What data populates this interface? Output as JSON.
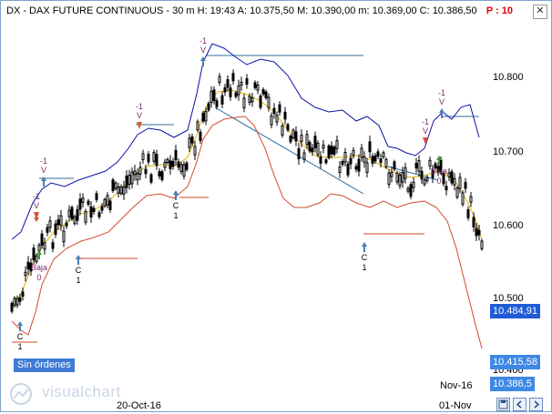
{
  "window": {
    "title": "DX - DAX FUTURE CONTINUOUS - 30 m  H: 19:43  A: 10.375,50  M: 10.390,00  m: 10.369,00  C: 10.386,50",
    "period_label": "P : 10",
    "close_glyph": "✕"
  },
  "price_axis": {
    "labels": [
      "10.800",
      "10.700",
      "10.600",
      "10.500",
      "10.400"
    ],
    "current_price_box": "10.484,91",
    "lower_box_1": "10.415,58",
    "lower_box_2": "10.386,5",
    "box_color_current": "#1f5bd6",
    "box_color_lower": "#3e88e6"
  },
  "date_axis": {
    "labels": [
      "20-Oct-16",
      "Nov-16",
      "01-Nov"
    ]
  },
  "status": {
    "no_orders_label": "Sin órdenes"
  },
  "logo": {
    "text": "visualchart"
  },
  "signals": [
    {
      "label": "C",
      "sub": "1"
    },
    {
      "label": "C",
      "sub": "1"
    },
    {
      "label": "C",
      "sub": "1"
    },
    {
      "label": "C",
      "sub": "1"
    },
    {
      "label": "-1",
      "sub": "V"
    },
    {
      "label": "-1",
      "sub": "V"
    },
    {
      "label": "-1",
      "sub": "V"
    },
    {
      "label": "-1",
      "sub": "V"
    },
    {
      "label": "-1",
      "sub": "V"
    },
    {
      "label": "-1",
      "sub": "V"
    },
    {
      "label": "Baja",
      "sub": "0"
    },
    {
      "label": "Baja",
      "sub": "0"
    }
  ],
  "colors": {
    "candles": "#000000",
    "upper_band": "#0a12a8",
    "mid_line": "#e2b400",
    "lower_band": "#d24a2e",
    "trendline": "#2f6e9e",
    "buy_arrow": "#4a7fb0",
    "sell_arrow": "#d9563a"
  }
}
